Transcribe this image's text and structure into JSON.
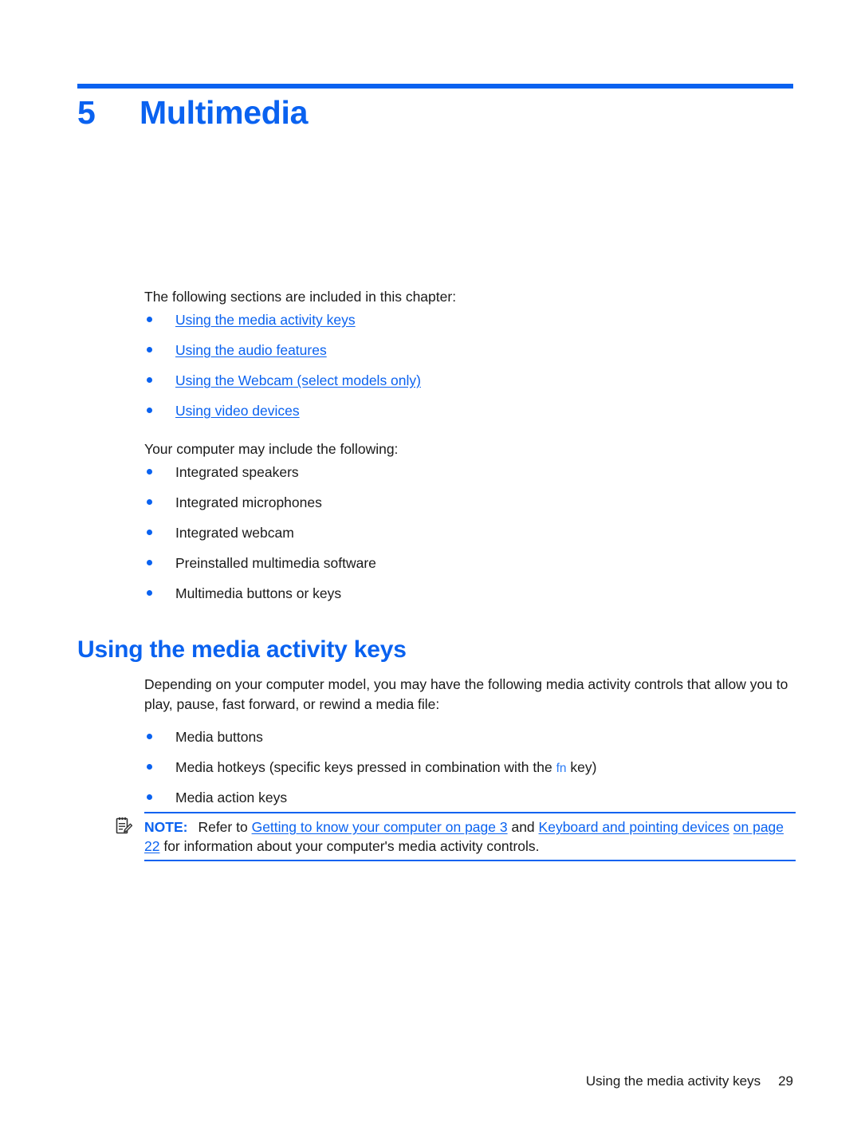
{
  "document": {
    "chapter_number": "5",
    "chapter_title": "Multimedia"
  },
  "intro": {
    "lead": "The following sections are included in this chapter:",
    "section_links": [
      {
        "label": "Using the media activity keys"
      },
      {
        "label": "Using the audio features"
      },
      {
        "label": "Using the Webcam (select models only)"
      },
      {
        "label": "Using video devices"
      }
    ],
    "lead2": "Your computer may include the following:",
    "features": [
      {
        "label": "Integrated speakers"
      },
      {
        "label": "Integrated microphones"
      },
      {
        "label": "Integrated webcam"
      },
      {
        "label": "Preinstalled multimedia software"
      },
      {
        "label": "Multimedia buttons or keys"
      }
    ]
  },
  "section": {
    "heading": "Using the media activity keys",
    "paragraph": "Depending on your computer model, you may have the following media activity controls that allow you to play, pause, fast forward, or rewind a media file:",
    "controls": [
      {
        "label": "Media buttons"
      },
      {
        "label": "Media action keys"
      }
    ],
    "hotkey_item": {
      "prefix": "Media hotkeys (specific keys pressed in combination with the ",
      "key": "fn",
      "suffix": " key)"
    }
  },
  "note": {
    "icon": "note-pencil-icon",
    "label": "NOTE:",
    "text_before": "Refer to ",
    "link1": "Getting to know your computer on page 3",
    "text_middle": " and ",
    "link2_part1": "Keyboard and pointing devices",
    "link2_part2": "on page 22",
    "text_after": " for information about your computer's media activity controls."
  },
  "footer": {
    "title": "Using the media activity keys",
    "page_number": "29"
  },
  "colors": {
    "accent_blue": "#0a62f0",
    "link_blue": "#0a62f0",
    "body_text": "#1a1a1a"
  }
}
